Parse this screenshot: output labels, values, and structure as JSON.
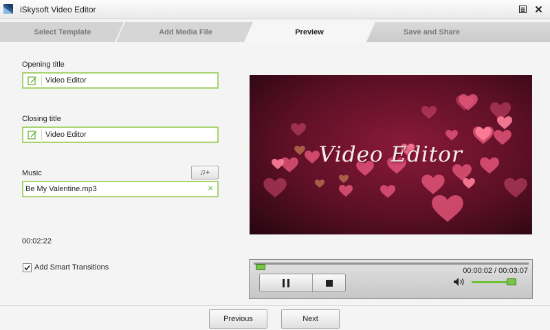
{
  "window": {
    "title": "iSkysoft Video Editor"
  },
  "steps": [
    {
      "label": "Select Template",
      "active": false
    },
    {
      "label": "Add Media File",
      "active": false
    },
    {
      "label": "Preview",
      "active": true
    },
    {
      "label": "Save and Share",
      "active": false
    }
  ],
  "form": {
    "opening_title_label": "Opening title",
    "opening_title_value": "Video Editor",
    "closing_title_label": "Closing title",
    "closing_title_value": "Video Editor",
    "music_label": "Music",
    "music_value": "Be My Valentine.mp3",
    "add_music_button": "♫+",
    "clear_music": "×",
    "duration": "00:02:22",
    "smart_transitions_label": "Add Smart Transitions",
    "smart_transitions_checked": true
  },
  "preview": {
    "overlay_text": "Video Editor"
  },
  "player": {
    "time_readout": "00:00:02 / 00:03:07",
    "playback_progress": 0.01,
    "volume_level": 0.78
  },
  "navigation": {
    "previous_label": "Previous",
    "next_label": "Next"
  },
  "colors": {
    "accent_green": "#7dc34a",
    "field_border": "#a8d46f",
    "preview_bg": "#5a0f24"
  }
}
